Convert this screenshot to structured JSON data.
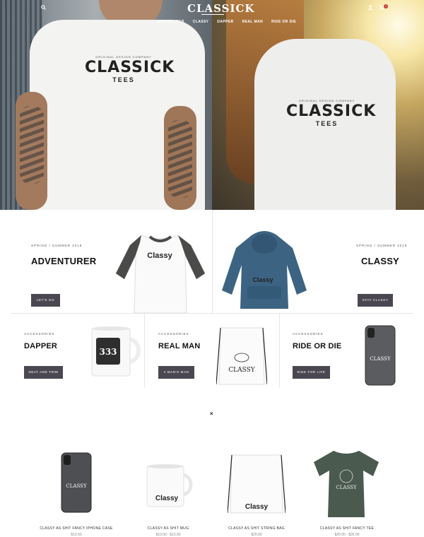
{
  "header": {
    "brand": "CLASSICK",
    "nav": [
      "ADVENTURER",
      "CLASSY",
      "DAPPER",
      "REAL MAN",
      "RIDE OR DIE"
    ],
    "cart_count": "0"
  },
  "hero": {
    "left_tee": {
      "tiny": "ORIGINAL DESIGN COMPANY",
      "big": "CLASSICK",
      "small": "TEES"
    },
    "right_tee": {
      "tiny": "ORIGINAL DESIGN COMPANY",
      "big": "CLASSICK",
      "small": "TEES"
    }
  },
  "features": [
    {
      "eyebrow": "SPRING / SUMMER 2019",
      "title": "ADVENTURER",
      "button": "LET'S GO",
      "print": "Classy"
    },
    {
      "eyebrow": "SPRING / SUMMER 2019",
      "title": "CLASSY",
      "button": "STAY CLASSY",
      "print": "Classy"
    }
  ],
  "accessories": [
    {
      "eyebrow": "ACCESSORIES",
      "title": "DAPPER",
      "button": "NEAT AND TRIM",
      "print": "333"
    },
    {
      "eyebrow": "ACCESSORIES",
      "title": "REAL MAN",
      "button": "A MAN'S MAN",
      "print": "CLASSY"
    },
    {
      "eyebrow": "ACCESSORIES",
      "title": "RIDE OR DIE",
      "button": "RIDE FOR LIFE",
      "print": "CLASSY"
    }
  ],
  "close_label": "×",
  "products": [
    {
      "name": "CLASSY AS SHIT FANCY IPHONE CASE",
      "price": "$13.50",
      "print": "CLASSY"
    },
    {
      "name": "CLASSY AS SHIT MUG",
      "price": "$10.00 - $13.00",
      "print": "Classy"
    },
    {
      "name": "CLASSY AS SHIT STRING BAG",
      "price": "$20.00",
      "print": "Classy"
    },
    {
      "name": "CLASSY AS SHIT FANCY TEE",
      "price": "$20.00 - $26.00",
      "print": "CLASSY"
    }
  ],
  "colors": {
    "button": "#4b4751",
    "accent_badge": "#c0392b"
  }
}
